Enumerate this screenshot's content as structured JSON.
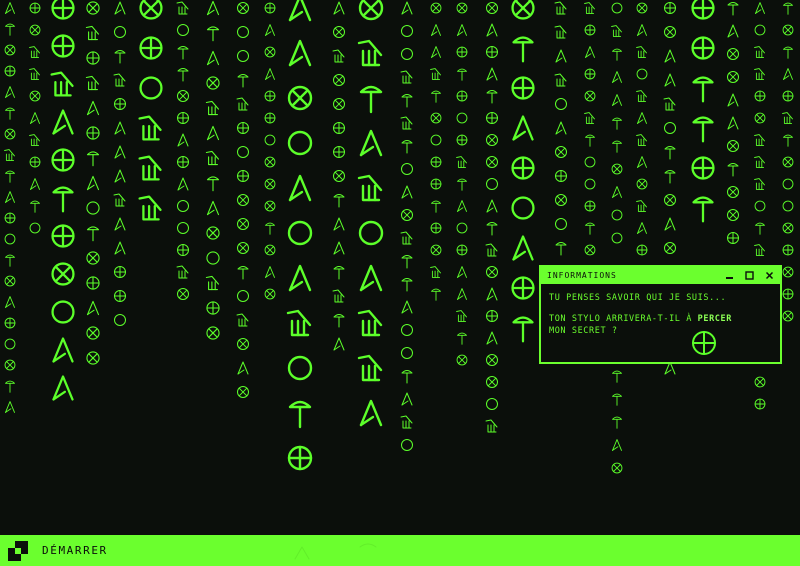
{
  "colors": {
    "accent": "#6bff2e",
    "background": "#0b0f0b"
  },
  "background_pattern": {
    "icon": "glyph-rain",
    "symbols": [
      "crossed-circle",
      "circled-plus",
      "caret",
      "pin",
      "circle",
      "tri-pi"
    ]
  },
  "dialog": {
    "title": "INFORMATIONS",
    "controls": {
      "minimize_icon": "minimize-icon",
      "maximize_icon": "maximize-icon",
      "close_icon": "close-icon"
    },
    "line1": "TU PENSES SAVOIR QUI JE SUIS...",
    "line2_before": "TON STYLO ARRIVERA-T-IL À ",
    "line2_emph": "PERCER",
    "line3": "MON SECRET ?",
    "glyph_icon": "circled-plus-icon"
  },
  "taskbar": {
    "start_icon": "start-logo-icon",
    "start_label": "DÉMARRER"
  }
}
